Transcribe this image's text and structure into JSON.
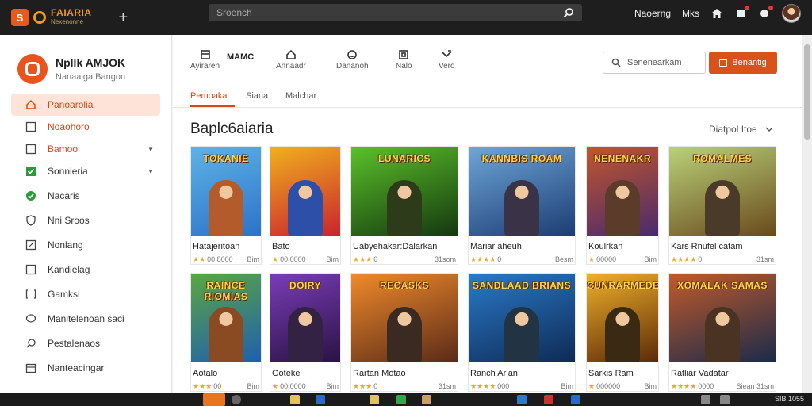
{
  "topbar": {
    "brand": "FAIARIA",
    "brand_sub": "Nexenonne",
    "search_placeholder": "Sroench",
    "nav_label_1": "Naoerng",
    "nav_label_2": "Mks"
  },
  "profile": {
    "name": "Npllk AMJOK",
    "sub": "Nanaaiga Bangon"
  },
  "sidebar": {
    "items": [
      {
        "label": "Panoarolia",
        "icon": "home-icon",
        "active": true
      },
      {
        "label": "Noaohoro",
        "icon": "square-icon"
      },
      {
        "label": "Bamoo",
        "icon": "square-icon",
        "caret": true
      },
      {
        "label": "Sonnieria",
        "icon": "checkbox-checked-icon",
        "caret": true
      },
      {
        "label": "Nacaris",
        "icon": "check-circle-icon"
      },
      {
        "label": "Nni Sroos",
        "icon": "shield-icon"
      },
      {
        "label": "Nonlang",
        "icon": "puzzle-icon"
      },
      {
        "label": "Kandielag",
        "icon": "square-icon"
      },
      {
        "label": "Gamksi",
        "icon": "bracket-icon"
      },
      {
        "label": "Manitelenoan saci",
        "icon": "chat-icon"
      },
      {
        "label": "Pestalenaos",
        "icon": "search-icon"
      },
      {
        "label": "Nanteacingar",
        "icon": "calendar-icon"
      }
    ]
  },
  "toolbar": {
    "title": "MAMC",
    "items": [
      {
        "label": "Ayiraren",
        "icon": "book-icon"
      },
      {
        "label": "Annaadr",
        "icon": "house-icon"
      },
      {
        "label": "Dananoh",
        "icon": "smile-icon"
      },
      {
        "label": "Nalo",
        "icon": "frame-icon"
      },
      {
        "label": "Vero",
        "icon": "arrows-icon"
      }
    ],
    "search_placeholder": "Senenearkam",
    "button_label": "Benantig"
  },
  "tabs": [
    {
      "label": "Pemoaka",
      "active": true
    },
    {
      "label": "Siaria"
    },
    {
      "label": "Malchar"
    }
  ],
  "section": {
    "title": "Baplc6aiaria",
    "sort_label": "Diatpol Itoe"
  },
  "games": [
    {
      "thumb_title": "TOKANIE",
      "name": "Hatajeritoan",
      "rating": "00 8000",
      "rating_stars": 2,
      "right": "Bim",
      "bg": [
        "#2a74c9",
        "#5fb2e6"
      ],
      "hero": "#b35b2a"
    },
    {
      "thumb_title": "",
      "name": "Bato",
      "rating": "00 0000",
      "rating_stars": 1,
      "right": "Bim",
      "bg": [
        "#c9242d",
        "#f0b01e"
      ],
      "hero": "#2d4fa8"
    },
    {
      "thumb_title": "LUNARICS",
      "name": "Uabyehakar:Dalarkan",
      "rating": "0",
      "rating_stars": 3,
      "right": "31som",
      "bg": [
        "#14380f",
        "#5bc12a"
      ],
      "hero": "#2d3b1a"
    },
    {
      "thumb_title": "KANNBIS ROAM",
      "name": "Mariar aheuh",
      "rating": "0",
      "rating_stars": 4,
      "right": "Besm",
      "bg": [
        "#1c3d74",
        "#6ea6d8"
      ],
      "hero": "#3a3348"
    },
    {
      "thumb_title": "NENENAKR",
      "name": "Koulrkan",
      "rating": "00000",
      "rating_stars": 1,
      "right": "Bim",
      "bg": [
        "#4a2a6e",
        "#c2562a"
      ],
      "hero": "#5b3b2a"
    },
    {
      "thumb_title": "ROMALMES",
      "name": "Kars Rnufel catam",
      "rating": "0",
      "rating_stars": 4,
      "right": "31sm",
      "bg": [
        "#6a4a1c",
        "#b9d27a"
      ],
      "hero": "#4a3a2a"
    },
    {
      "thumb_title": "RAINCE RIOMIAS",
      "name": "Aotalo",
      "rating": "00",
      "rating_stars": 3,
      "right": "Bim",
      "bg": [
        "#1e5fb0",
        "#5ba642"
      ],
      "hero": "#8a4a22"
    },
    {
      "thumb_title": "DOIRY",
      "name": "Goteke",
      "rating": "00 0000",
      "rating_stars": 1,
      "right": "Bim",
      "bg": [
        "#2a1244",
        "#7a3cb8"
      ],
      "hero": "#332244"
    },
    {
      "thumb_title": "RECASKS",
      "name": "Rartan Motao",
      "rating": "0",
      "rating_stars": 3,
      "right": "31sm",
      "bg": [
        "#5a2a18",
        "#f08a2a"
      ],
      "hero": "#3a2a22"
    },
    {
      "thumb_title": "SANDLAAD BRIANS",
      "name": "Ranch Arian",
      "rating": "000",
      "rating_stars": 4,
      "right": "Bim",
      "bg": [
        "#0e2a55",
        "#2a7ac9"
      ],
      "hero": "#223344"
    },
    {
      "thumb_title": "CUNRARMEDE",
      "name": "Sarkis Ram",
      "rating": "000000",
      "rating_stars": 1,
      "right": "Bim",
      "bg": [
        "#5a2a08",
        "#f0b02a"
      ],
      "hero": "#3a2a14"
    },
    {
      "thumb_title": "XOMALAK SAMAS",
      "name": "Ratliar Vadatar",
      "rating": "0000",
      "rating_stars": 4,
      "right": "Siean 31sm",
      "bg": [
        "#1a2a4a",
        "#c25a2a"
      ],
      "hero": "#4a3322"
    }
  ],
  "taskbar": {
    "tray": "SIB 1055"
  }
}
